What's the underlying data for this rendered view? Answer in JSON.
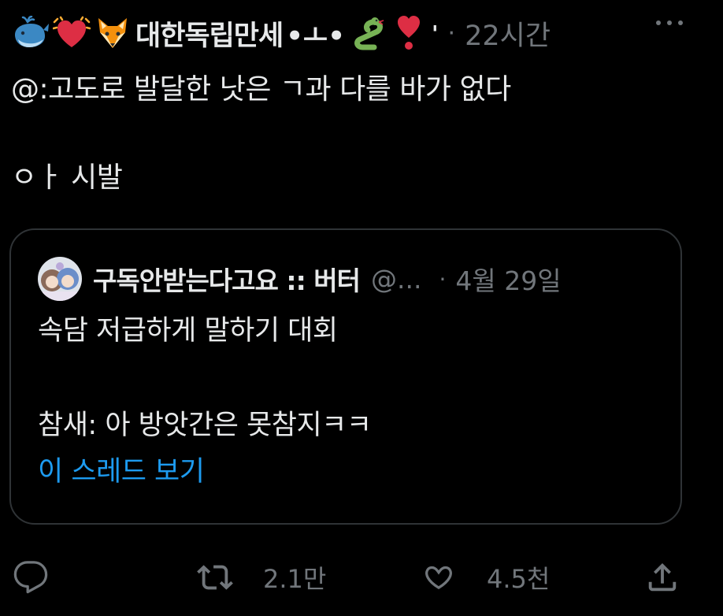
{
  "tweet": {
    "author": {
      "emojis": [
        "whale-icon",
        "beating-heart-icon",
        "fox-icon"
      ],
      "name": "대한독립만세",
      "name_suffix": "•ㅗ•",
      "trailing_emojis": [
        "snake-icon",
        "heart-exclamation-icon"
      ],
      "trailing_mark": "'"
    },
    "separator": "·",
    "time": "22시간",
    "text_lines": [
      "@:고도로 발달한 낫은 ㄱ과 다를 바가 없다",
      "",
      "ㅇㅏ 시발"
    ],
    "more_icon": "more-icon"
  },
  "quote": {
    "avatar_icon": "avatar-icon",
    "name": "구독안받는다고요 :: 버터",
    "handle": "@...",
    "separator": "·",
    "date": "4월 29일",
    "text_lines": [
      "속담 저급하게 말하기 대회",
      "",
      "참새: 아 방앗간은 못참지ㅋㅋ"
    ],
    "thread_link": "이 스레드 보기"
  },
  "actions": {
    "reply": {
      "icon": "reply-icon"
    },
    "retweet": {
      "icon": "retweet-icon",
      "count": "2.1만"
    },
    "like": {
      "icon": "heart-icon",
      "count": "4.5천"
    },
    "share": {
      "icon": "share-icon"
    }
  },
  "colors": {
    "background": "#000000",
    "text": "#e7e9ea",
    "secondary": "#71767b",
    "link": "#1d9bf0",
    "border": "#2f3336"
  }
}
